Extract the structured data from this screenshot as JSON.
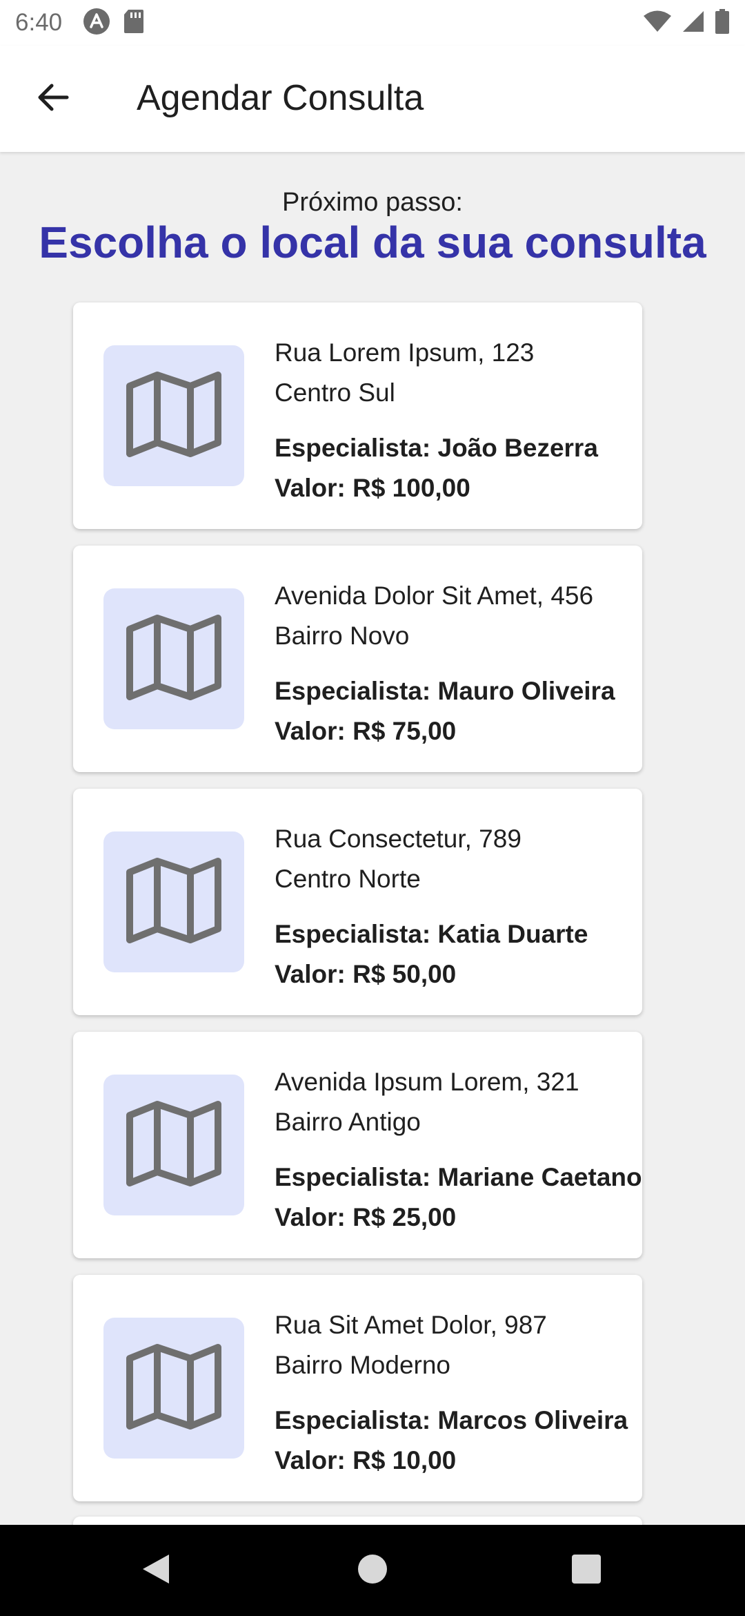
{
  "status_bar": {
    "time": "6:40",
    "icons_left": [
      "android-icon",
      "sd-card-icon"
    ],
    "icons_right": [
      "wifi-icon",
      "signal-icon",
      "battery-icon"
    ]
  },
  "app_bar": {
    "title": "Agendar Consulta",
    "back_icon": "arrow-back-icon"
  },
  "header": {
    "step_label": "Próximo passo:",
    "heading": "Escolha o local da sua consulta"
  },
  "locations": [
    {
      "address": "Rua Lorem Ipsum, 123",
      "neighborhood": "Centro Sul",
      "specialist": "Especialista: João Bezerra",
      "price": "Valor: R$ 100,00",
      "icon": "map-icon"
    },
    {
      "address": "Avenida Dolor Sit Amet, 456",
      "neighborhood": "Bairro Novo",
      "specialist": "Especialista: Mauro Oliveira",
      "price": "Valor: R$ 75,00",
      "icon": "map-icon"
    },
    {
      "address": "Rua Consectetur, 789",
      "neighborhood": "Centro Norte",
      "specialist": "Especialista: Katia Duarte",
      "price": "Valor: R$ 50,00",
      "icon": "map-icon"
    },
    {
      "address": "Avenida Ipsum Lorem, 321",
      "neighborhood": "Bairro Antigo",
      "specialist": "Especialista: Mariane Caetano",
      "price": "Valor: R$ 25,00",
      "icon": "map-icon"
    },
    {
      "address": "Rua Sit Amet Dolor, 987",
      "neighborhood": "Bairro Moderno",
      "specialist": "Especialista: Marcos Oliveira",
      "price": "Valor: R$ 10,00",
      "icon": "map-icon"
    }
  ],
  "nav_bar": {
    "icons": [
      "nav-back-icon",
      "nav-home-icon",
      "nav-recents-icon"
    ]
  },
  "colors": {
    "heading": "#3533a8",
    "thumb_bg": "#dfe4fb",
    "map_icon": "#6f6f6f",
    "background": "#f0f0f0"
  }
}
